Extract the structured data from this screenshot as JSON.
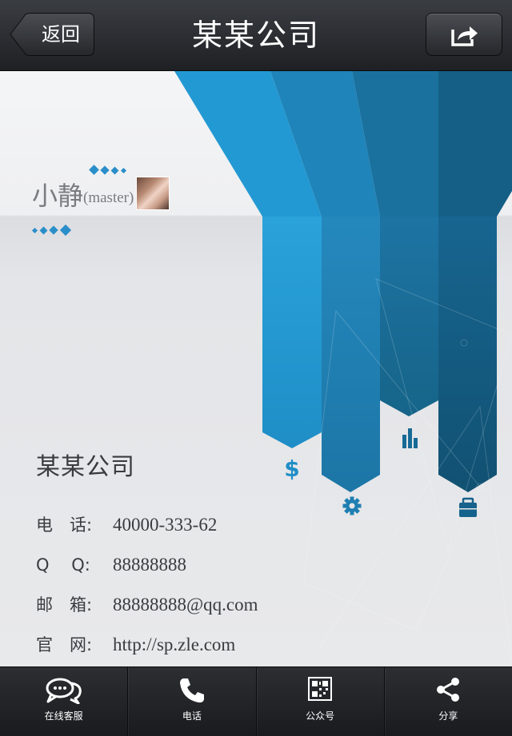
{
  "nav": {
    "title": "某某公司",
    "back_label": "返回",
    "share_icon": "share-export-icon"
  },
  "card": {
    "person": {
      "name": "小静",
      "role": "(master)"
    },
    "company": "某某公司",
    "info": [
      {
        "label": "电　话:",
        "value": "40000-333-62"
      },
      {
        "label": "Q　 Q:",
        "value": "88888888"
      },
      {
        "label": "邮　箱:",
        "value": "88888888@qq.com"
      },
      {
        "label": "官　网:",
        "value": "http://sp.zle.com"
      }
    ],
    "ribbon_icons": [
      "dollar-icon",
      "gear-icon",
      "bar-chart-icon",
      "briefcase-icon"
    ],
    "accent_colors": [
      "#2596cf",
      "#1e7fb0",
      "#176a96",
      "#125676"
    ]
  },
  "tabs": [
    {
      "label": "在线客服",
      "icon": "chat-bubbles-icon"
    },
    {
      "label": "电话",
      "icon": "phone-icon"
    },
    {
      "label": "公众号",
      "icon": "qr-code-icon"
    },
    {
      "label": "分享",
      "icon": "share-nodes-icon"
    }
  ]
}
